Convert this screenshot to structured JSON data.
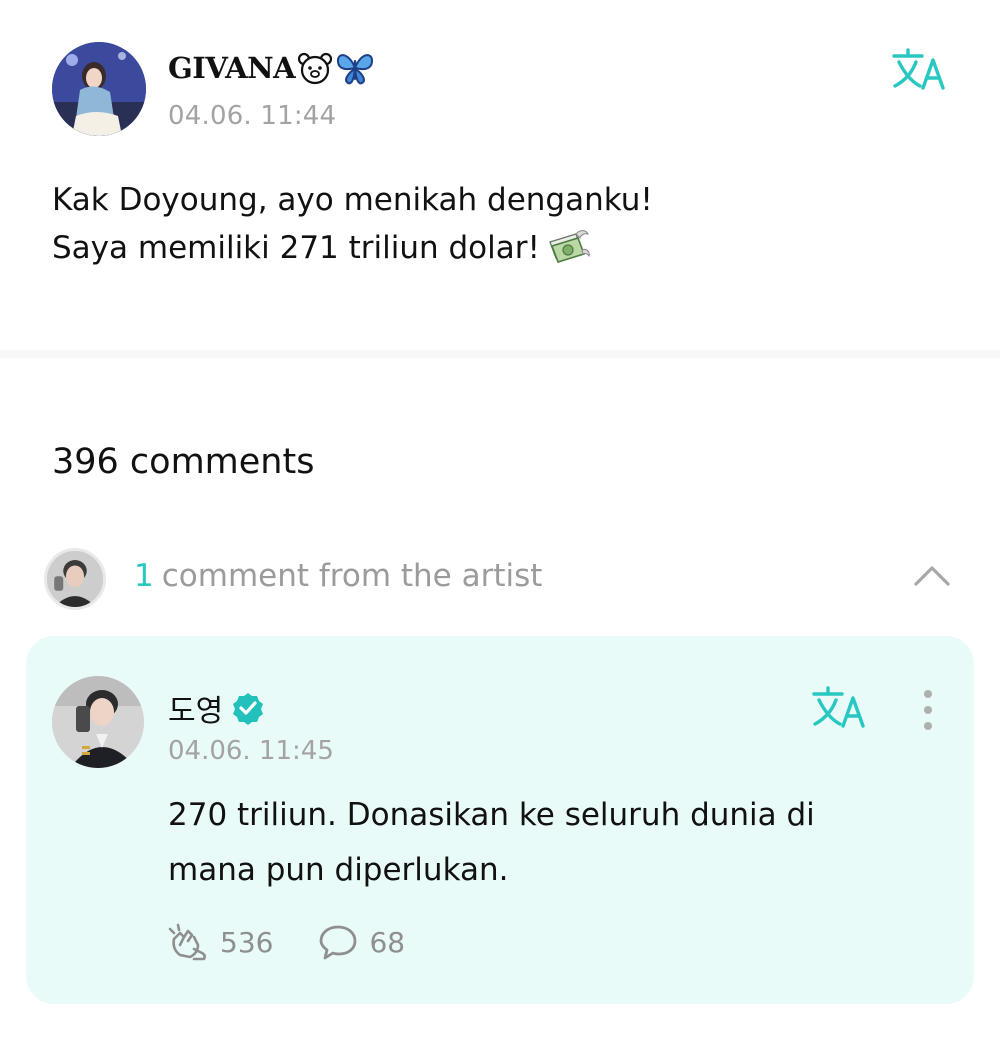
{
  "colors": {
    "accent_teal": "#28c7c2",
    "artist_card_bg": "#e9fbf9",
    "muted_text": "#a3a3a3",
    "verified_badge": "#23c1bb"
  },
  "post": {
    "author_name": "GIVANA",
    "author_name_decoration_icons": [
      "bear-face-icon",
      "butterfly-icon"
    ],
    "timestamp": "04.06. 11:44",
    "translate_icon": "translate-icon",
    "body_lines": [
      "Kak Doyoung, ayo menikah denganku!",
      "Saya memiliki 271 triliun dolar!"
    ],
    "body_emoji": "money-with-wings-icon"
  },
  "comments": {
    "count_label": "396 comments",
    "artist_section": {
      "count": "1",
      "label": "comment from the artist",
      "toggle_icon": "chevron-up-icon"
    },
    "artist_comment": {
      "author_name": "도영",
      "verified_icon": "verified-badge-icon",
      "timestamp": "04.06. 11:45",
      "translate_icon": "translate-icon",
      "more_icon": "more-vertical-icon",
      "body_lines": [
        "270 triliun. Donasikan ke seluruh dunia di",
        "mana pun diperlukan."
      ],
      "likes": "536",
      "replies": "68",
      "like_icon": "cheer-hands-icon",
      "reply_icon": "speech-bubble-icon"
    }
  }
}
